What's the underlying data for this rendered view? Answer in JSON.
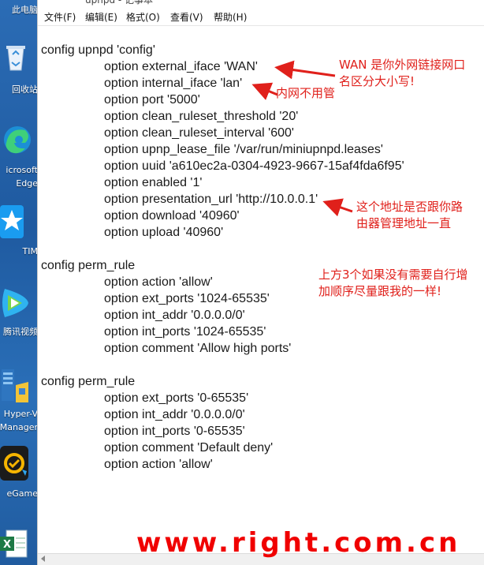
{
  "desktop": {
    "items": [
      {
        "label": "此电脑",
        "icon": "pc-icon"
      },
      {
        "label": "回收站",
        "icon": "recycle-bin-icon"
      },
      {
        "label": "icrosoft\nEdge",
        "icon": "edge-icon"
      },
      {
        "label": "TIM",
        "icon": "tim-icon"
      },
      {
        "label": "腾讯视频",
        "icon": "tencent-video-icon"
      },
      {
        "label": "Hyper-V\nManager",
        "icon": "hyper-v-icon"
      },
      {
        "label": "eGame",
        "icon": "egame-icon"
      },
      {
        "label": "",
        "icon": "excel-icon"
      }
    ]
  },
  "window": {
    "title": "upnpd - 记事本",
    "menu": [
      "文件(F)",
      "编辑(E)",
      "格式(O)",
      "查看(V)",
      "帮助(H)"
    ]
  },
  "editor": {
    "lines": [
      "config upnpd 'config'",
      "option external_iface 'WAN'",
      "option internal_iface 'lan'",
      "option port '5000'",
      "option clean_ruleset_threshold '20'",
      "option clean_ruleset_interval '600'",
      "option upnp_lease_file '/var/run/miniupnpd.leases'",
      "option uuid 'a610ec2a-0304-4923-9667-15af4fda6f95'",
      "option enabled '1'",
      "option presentation_url 'http://10.0.0.1'",
      "option download '40960'",
      "option upload '40960'",
      "config perm_rule",
      "option action 'allow'",
      "option ext_ports '1024-65535'",
      "option int_addr '0.0.0.0/0'",
      "option int_ports '1024-65535'",
      "option comment 'Allow high ports'",
      "config perm_rule",
      "option ext_ports '0-65535'",
      "option int_addr '0.0.0.0/0'",
      "option int_ports '0-65535'",
      "option comment 'Default deny'",
      "option action 'allow'"
    ]
  },
  "annotations": {
    "wan_note": "WAN 是你外网链接网口\n名区分大小写!",
    "lan_note": "内网不用管",
    "url_note": "这个地址是否跟你路\n由器管理地址一直",
    "rules_note": "上方3个如果没有需要自行增\n加顺序尽量跟我的一样!"
  },
  "watermark": "www.right.com.cn",
  "colors": {
    "annotation": "#e0201b",
    "watermark": "#f00000"
  }
}
